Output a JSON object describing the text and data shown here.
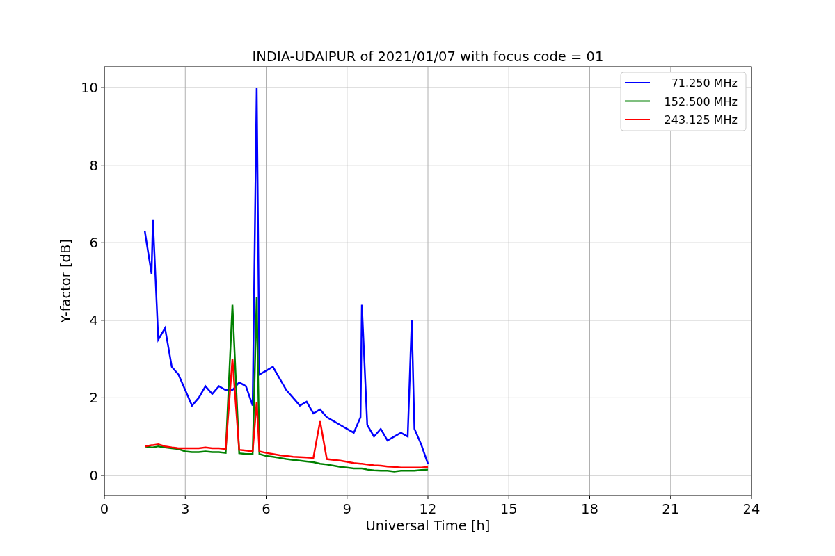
{
  "figure": {
    "chart_data": {
      "type": "line",
      "title": "INDIA-UDAIPUR of 2021/01/07 with focus code = 01",
      "xlabel": "Universal Time [h]",
      "ylabel": "Y-factor [dB]",
      "x": [
        1.5,
        1.75,
        1.8,
        2,
        2.25,
        2.5,
        2.75,
        3,
        3.25,
        3.5,
        3.75,
        4,
        4.25,
        4.5,
        4.75,
        5,
        5.25,
        5.5,
        5.65,
        5.75,
        6,
        6.25,
        6.5,
        6.75,
        7,
        7.25,
        7.5,
        7.75,
        8,
        8.25,
        8.5,
        8.75,
        9,
        9.25,
        9.5,
        9.55,
        9.75,
        10,
        10.25,
        10.5,
        10.75,
        11,
        11.25,
        11.4,
        11.5,
        11.75,
        12
      ],
      "series": [
        {
          "name": "71.250 MHz",
          "color": "#0000ff",
          "values": [
            6.3,
            5.2,
            6.6,
            3.5,
            3.8,
            2.8,
            2.6,
            2.2,
            1.8,
            2.0,
            2.3,
            2.1,
            2.3,
            2.2,
            2.2,
            2.4,
            2.3,
            1.8,
            10.0,
            2.6,
            2.7,
            2.8,
            2.5,
            2.2,
            2.0,
            1.8,
            1.9,
            1.6,
            1.7,
            1.5,
            1.4,
            1.3,
            1.2,
            1.1,
            1.5,
            4.4,
            1.3,
            1.0,
            1.2,
            0.9,
            1.0,
            1.1,
            1.0,
            4.0,
            1.2,
            0.8,
            0.3
          ]
        },
        {
          "name": "152.500 MHz",
          "color": "#008000",
          "values": [
            0.75,
            0.72,
            0.72,
            0.75,
            0.72,
            0.7,
            0.68,
            0.62,
            0.6,
            0.6,
            0.62,
            0.6,
            0.6,
            0.58,
            4.4,
            0.57,
            0.55,
            0.55,
            4.6,
            0.55,
            0.5,
            0.48,
            0.45,
            0.42,
            0.4,
            0.38,
            0.36,
            0.34,
            0.3,
            0.28,
            0.25,
            0.22,
            0.2,
            0.18,
            0.18,
            0.18,
            0.15,
            0.13,
            0.12,
            0.12,
            0.1,
            0.12,
            0.12,
            0.12,
            0.12,
            0.14,
            0.15
          ]
        },
        {
          "name": "243.125 MHz",
          "color": "#ff0000",
          "values": [
            0.75,
            0.78,
            0.78,
            0.8,
            0.75,
            0.72,
            0.7,
            0.7,
            0.7,
            0.7,
            0.72,
            0.7,
            0.7,
            0.68,
            3.0,
            0.66,
            0.64,
            0.62,
            1.9,
            0.62,
            0.58,
            0.55,
            0.52,
            0.5,
            0.48,
            0.47,
            0.46,
            0.45,
            1.4,
            0.42,
            0.4,
            0.38,
            0.35,
            0.32,
            0.3,
            0.3,
            0.28,
            0.26,
            0.25,
            0.23,
            0.22,
            0.2,
            0.2,
            0.2,
            0.2,
            0.2,
            0.22
          ]
        }
      ],
      "grid": true,
      "legend": "upper right",
      "xlim": [
        0,
        24
      ],
      "ylim": [
        -0.52,
        10.54
      ],
      "xticks": [
        0,
        3,
        6,
        9,
        12,
        15,
        18,
        21,
        24
      ],
      "yticks": [
        0,
        2,
        4,
        6,
        8,
        10
      ]
    }
  }
}
